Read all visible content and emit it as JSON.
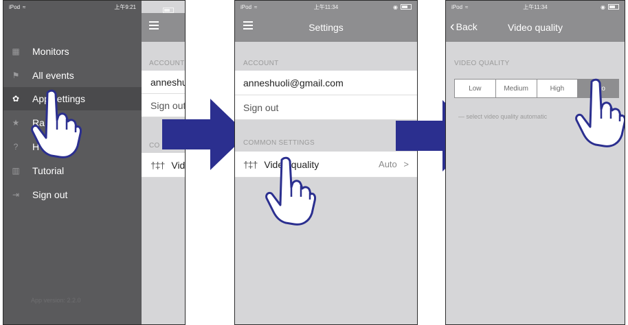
{
  "phone1": {
    "status": {
      "carrier": "iPod",
      "time": "上午9:21"
    },
    "menu": {
      "items": [
        {
          "label": "Monitors",
          "icon": "grid-icon"
        },
        {
          "label": "All events",
          "icon": "flag-icon"
        },
        {
          "label": "App settings",
          "icon": "gear-icon"
        },
        {
          "label": "Ra",
          "icon": "star-icon"
        },
        {
          "label": "H",
          "icon": "help-icon"
        },
        {
          "label": "Tutorial",
          "icon": "book-icon"
        },
        {
          "label": "Sign out",
          "icon": "sign-out-icon"
        }
      ],
      "version": "App version: 2.2.0"
    },
    "behind": {
      "account_header": "ACCOUNT",
      "email_partial": "anneshu",
      "signout_partial": "Sign out",
      "common_partial": "CO",
      "video_partial": "Vid"
    }
  },
  "phone2": {
    "status": {
      "carrier": "iPod",
      "time": "上午11:34"
    },
    "nav_title": "Settings",
    "account_header": "ACCOUNT",
    "email": "anneshuoli@gmail.com",
    "signout": "Sign out",
    "common_header": "COMMON SETTINGS",
    "video_quality_label": "Video quality",
    "video_quality_value": "Auto",
    "chevron": ">"
  },
  "phone3": {
    "status": {
      "carrier": "iPod",
      "time": "上午11:34"
    },
    "back_label": "Back",
    "nav_title": "Video quality",
    "section_header": "VIDEO QUALITY",
    "options": [
      "Low",
      "Medium",
      "High",
      "Auto"
    ],
    "selected": "Auto",
    "hint": "— select video quality automatic"
  },
  "colors": {
    "navbar": "#8e8e90",
    "menu": "#5a5a5c",
    "arrow": "#2b2f8f",
    "background": "#d6d6d8"
  }
}
